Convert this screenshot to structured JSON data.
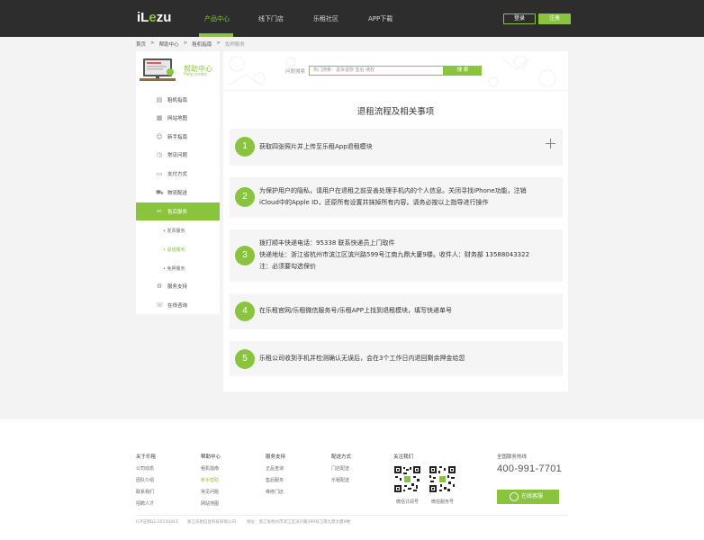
{
  "header": {
    "logo_pre": "iL",
    "logo_o": "e",
    "logo_post": "zu",
    "nav": [
      {
        "label": "产品中心",
        "active": true
      },
      {
        "label": "线下门店",
        "active": false
      },
      {
        "label": "乐租社区",
        "active": false
      },
      {
        "label": "APP下载",
        "active": false
      }
    ],
    "login": "登录",
    "register": "注册"
  },
  "breadcrumb": [
    "首页",
    ">",
    "帮助中心",
    ">",
    "租机指南",
    ">",
    "免押服务"
  ],
  "help": {
    "title": "帮助中心",
    "subtitle": "Help center"
  },
  "search": {
    "label": "问题搜索",
    "placeholder": "热门搜索：退货退款  售后  续权",
    "button": "搜 索"
  },
  "sidebar": {
    "items": [
      {
        "label": "租机指南",
        "icon": "document-icon"
      },
      {
        "label": "网站地图",
        "icon": "map-icon"
      },
      {
        "label": "新手指南",
        "icon": "user-icon"
      },
      {
        "label": "常见问题",
        "icon": "question-icon"
      },
      {
        "label": "支付方式",
        "icon": "card-icon"
      },
      {
        "label": "物流配送",
        "icon": "truck-icon"
      },
      {
        "label": "售后服务",
        "icon": "tools-icon"
      },
      {
        "label": "服务支持",
        "icon": "support-icon"
      },
      {
        "label": "在线咨询",
        "icon": "chat-icon"
      }
    ],
    "sub_items": [
      "• 发票服务",
      "• 退租服务",
      "• 免押服务"
    ]
  },
  "content": {
    "title": "退租流程及相关事项",
    "steps": [
      {
        "num": "1",
        "lines": [
          "获取四张照片并上传至乐租App退租模块"
        ]
      },
      {
        "num": "2",
        "lines": [
          "为保护用户的隐私，请用户在退租之前妥善处理手机内的个人信息。关闭寻找iPhone功能，注销",
          "iCloud中的Apple ID，还原所有设置并抹掉所有内容。请务必按以上指导进行操作"
        ]
      },
      {
        "num": "3",
        "lines": [
          " 拨打顺丰快递电话：95338 联系快递员上门取件",
          "快递地址：浙江省杭州市滨江区滨兴路599号江南九鼎大厦9楼。收件人：财务部 13588043322",
          "注：必须要勾选保价"
        ]
      },
      {
        "num": "4",
        "lines": [
          "在乐租官网/乐租微信服务号/乐租APP上找到退租模块，填写快递单号"
        ]
      },
      {
        "num": "5",
        "lines": [
          "乐租公司收到手机并检测确认无误后，会在3个工作日内退回剩余押金给您"
        ]
      }
    ]
  },
  "footer": {
    "columns": [
      {
        "title": "关于乐租",
        "links": [
          "公司动态",
          "团队介绍",
          "联系我们",
          "招聘人才"
        ]
      },
      {
        "title": "帮助中心",
        "links": [
          "租机指南",
          "新手帮助",
          "常见问题",
          "网站地图"
        ]
      },
      {
        "title": "服务支持",
        "links": [
          "正品查询",
          "售后服务",
          "维修门店"
        ]
      },
      {
        "title": "配送方式",
        "links": [
          "门店配送",
          "乐租配送"
        ]
      }
    ],
    "follow": {
      "title": "关注我们",
      "qr_captions": [
        "微信订阅号",
        "微信服务号"
      ]
    },
    "hotline_label": "全国服务热线",
    "hotline": "400-991-7701",
    "online_service": "在线客服",
    "icp": "ICP证浙B2-20150443",
    "company": "浙江乐租信息科技有限公司",
    "address": "地址：浙江省杭州市滨江区滨兴路599号江南九鼎大厦9楼"
  },
  "colors": {
    "accent": "#8ac43f",
    "header_bg": "#2d2d2d"
  }
}
